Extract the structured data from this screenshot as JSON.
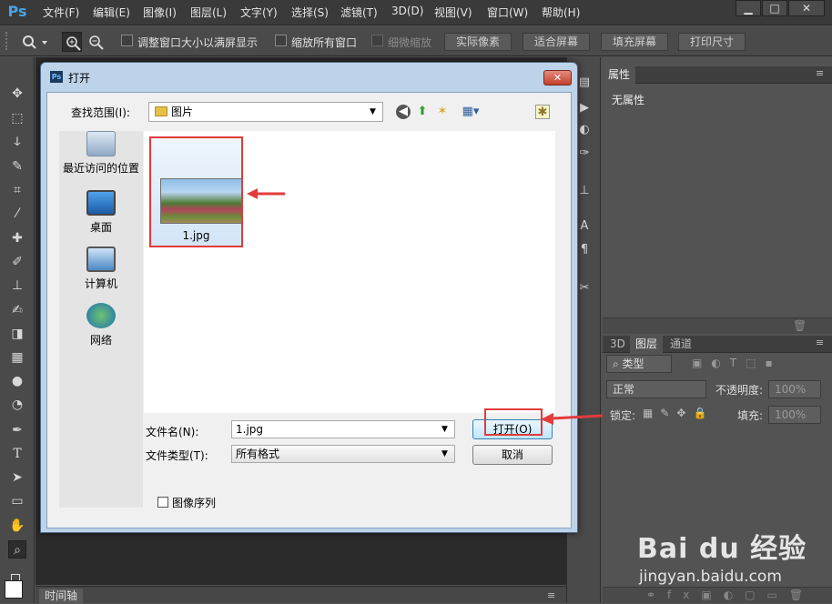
{
  "app": {
    "logo": "Ps"
  },
  "menubar": {
    "items": [
      "文件(F)",
      "编辑(E)",
      "图像(I)",
      "图层(L)",
      "文字(Y)",
      "选择(S)",
      "滤镜(T)",
      "3D(D)",
      "视图(V)",
      "窗口(W)",
      "帮助(H)"
    ],
    "min": "▁",
    "max": "□",
    "close": "✕"
  },
  "options": {
    "resize_window": "调整窗口大小以满屏显示",
    "zoom_all": "缩放所有窗口",
    "scrubby_zoom": "细微缩放",
    "actual_pixels": "实际像素",
    "fit_screen": "适合屏幕",
    "fill_screen": "填充屏幕",
    "print_size": "打印尺寸"
  },
  "timeline": {
    "tab": "时间轴"
  },
  "properties_panel": {
    "tab": "属性",
    "content": "无属性"
  },
  "layers_panel": {
    "tabs": [
      "3D",
      "图层",
      "通道"
    ],
    "kind": "类型",
    "blend_mode": "正常",
    "opacity_label": "不透明度:",
    "opacity_value": "100%",
    "lock_label": "锁定:",
    "fill_label": "填充:",
    "fill_value": "100%"
  },
  "dialog": {
    "title_icon": "Ps",
    "title": "打开",
    "close": "✕",
    "look_in_label": "查找范围(I):",
    "look_in_value": "图片",
    "places": [
      "最近访问的位置",
      "桌面",
      "计算机",
      "网络"
    ],
    "file": {
      "name": "1.jpg"
    },
    "filename_label": "文件名(N):",
    "filename_value": "1.jpg",
    "filetype_label": "文件类型(T):",
    "filetype_value": "所有格式",
    "open_button": "打开(O)",
    "cancel_button": "取消",
    "image_sequence": "图像序列"
  },
  "watermark": {
    "brand": "Bai du 经验",
    "url": "jingyan.baidu.com"
  },
  "colors": {
    "highlight": "#e23b3b",
    "ps_blue": "#4aa3e8"
  }
}
